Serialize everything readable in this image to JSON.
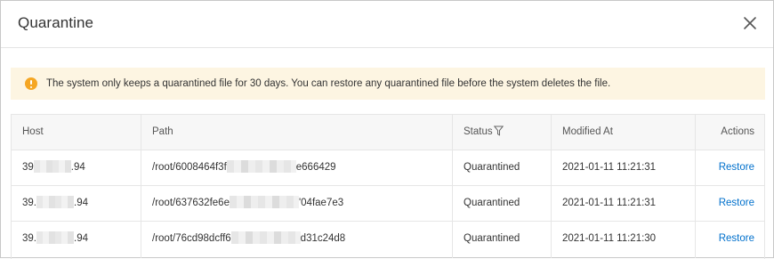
{
  "dialog": {
    "title": "Quarantine",
    "close_icon": "close-icon"
  },
  "notice": {
    "icon": "warning-icon",
    "color": "#f5a623",
    "background": "#fdf5e2",
    "text": "The system only keeps a quarantined file for 30 days. You can restore any quarantined file before the system deletes the file."
  },
  "table": {
    "columns": {
      "host": "Host",
      "path": "Path",
      "status": "Status",
      "modified": "Modified At",
      "actions": "Actions"
    },
    "status_filter_icon": "filter-icon",
    "rows": [
      {
        "host_prefix": "39",
        "host_suffix": ".94",
        "path_prefix": "/root/6008464f3f",
        "path_suffix": "e666429",
        "status": "Quarantined",
        "modified": "2021-01-11 11:21:31",
        "action": "Restore"
      },
      {
        "host_prefix": "39.",
        "host_suffix": ".94",
        "path_prefix": "/root/637632fe6e",
        "path_suffix": "'04fae7e3",
        "status": "Quarantined",
        "modified": "2021-01-11 11:21:31",
        "action": "Restore"
      },
      {
        "host_prefix": "39.",
        "host_suffix": ".94",
        "path_prefix": "/root/76cd98dcff6",
        "path_suffix": "d31c24d8",
        "status": "Quarantined",
        "modified": "2021-01-11 11:21:30",
        "action": "Restore"
      }
    ]
  },
  "colors": {
    "link": "#0070cc",
    "header_bg": "#f7f7f7",
    "border": "#e6e6e6"
  }
}
